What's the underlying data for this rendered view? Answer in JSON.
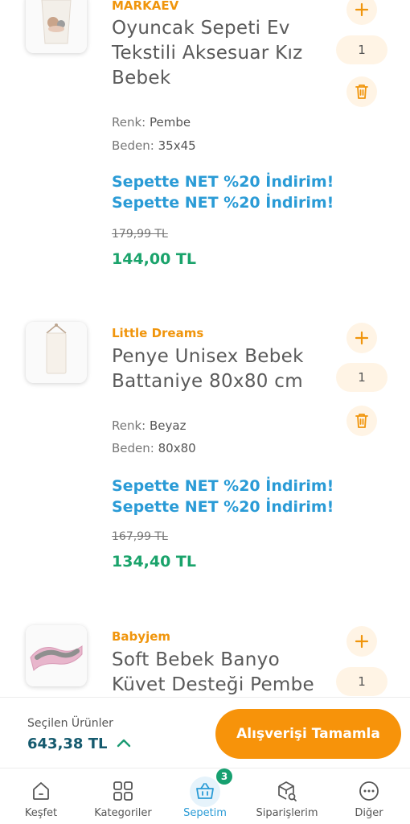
{
  "cart_items": [
    {
      "brand": "MARKAEV",
      "title_line1": "Oyuncak Sepeti Ev",
      "title_line2": "Tekstili Aksesuar Kız",
      "title_line3": "Bebek",
      "color_label": "Renk:",
      "color_value": "Pembe",
      "size_label": "Beden:",
      "size_value": "35x45",
      "promo1": "Sepette NET %20 İndirim!",
      "promo2": "Sepette NET %20 İndirim!",
      "old_price": "179,99 TL",
      "new_price": "144,00 TL",
      "quantity": "1"
    },
    {
      "brand": "Little Dreams",
      "title_line1": "Penye Unisex Bebek",
      "title_line2": "Battaniye 80x80 cm",
      "color_label": "Renk:",
      "color_value": "Beyaz",
      "size_label": "Beden:",
      "size_value": "80x80",
      "promo1": "Sepette NET %20 İndirim!",
      "promo2": "Sepette NET %20 İndirim!",
      "old_price": "167,99 TL",
      "new_price": "134,40 TL",
      "quantity": "1"
    },
    {
      "brand": "Babyjem",
      "title_line1": "Soft Bebek Banyo",
      "title_line2": "Küvet Desteği Pembe",
      "quantity": "1"
    }
  ],
  "summary": {
    "label": "Seçilen Ürünler",
    "total": "643,38 TL",
    "checkout_label": "Alışverişi Tamamla"
  },
  "tabs": [
    {
      "label": "Keşfet",
      "icon": "home-icon"
    },
    {
      "label": "Kategoriler",
      "icon": "grid-icon"
    },
    {
      "label": "Sepetim",
      "icon": "basket-icon",
      "active": true,
      "badge": "3"
    },
    {
      "label": "Siparişlerim",
      "icon": "package-search-icon"
    },
    {
      "label": "Diğer",
      "icon": "more-icon"
    }
  ],
  "colors": {
    "brand_orange": "#f0950c",
    "promo_blue": "#2a9bd6",
    "price_green": "#1aa36b",
    "checkout_orange": "#f7930a",
    "total_teal": "#155a6e"
  }
}
